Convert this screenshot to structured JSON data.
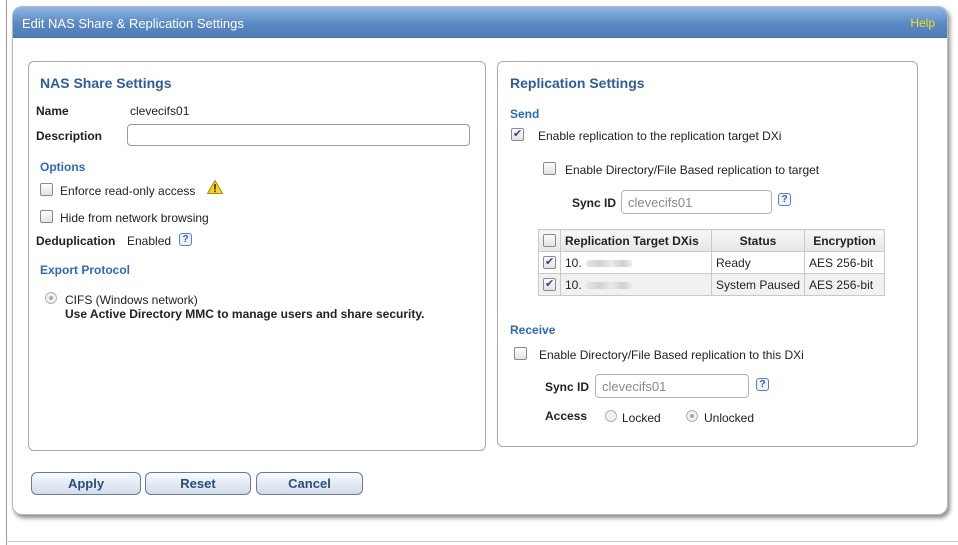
{
  "dialog": {
    "title": "Edit NAS Share & Replication Settings",
    "help": "Help"
  },
  "nas": {
    "title": "NAS Share Settings",
    "name_label": "Name",
    "name_value": "clevecifs01",
    "description_label": "Description",
    "description_value": "",
    "options_heading": "Options",
    "readonly_label": "Enforce read-only access",
    "hide_label": "Hide from network browsing",
    "dedup_label": "Deduplication",
    "dedup_value": "Enabled",
    "export_heading": "Export Protocol",
    "cifs_label": "CIFS (Windows network)",
    "cifs_note": "Use Active Directory MMC to manage users and share security."
  },
  "replication": {
    "title": "Replication Settings",
    "send_heading": "Send",
    "enable_send_label": "Enable replication to the replication target DXi",
    "enable_send_checked": true,
    "enable_dir_send_label": "Enable Directory/File Based replication to target",
    "send_sync_label": "Sync ID",
    "send_sync_value": "clevecifs01",
    "table": {
      "headers": [
        "Replication Target DXis",
        "Status",
        "Encryption"
      ],
      "rows": [
        {
          "target": "10.",
          "status": "Ready",
          "encryption": "AES 256-bit",
          "checked": true
        },
        {
          "target": "10.",
          "status": "System Paused",
          "encryption": "AES 256-bit",
          "checked": true
        }
      ]
    },
    "receive_heading": "Receive",
    "enable_dir_receive_label": "Enable Directory/File Based replication to this DXi",
    "receive_sync_label": "Sync ID",
    "receive_sync_value": "clevecifs01",
    "access_label": "Access",
    "locked_label": "Locked",
    "unlocked_label": "Unlocked",
    "access_selected": "Unlocked"
  },
  "buttons": {
    "apply": "Apply",
    "reset": "Reset",
    "cancel": "Cancel"
  },
  "icons": {
    "help": "question-mark-icon",
    "warning": "warning-triangle-icon"
  },
  "colors": {
    "title_bar": "#5b89c4",
    "help_link": "#f3e11a",
    "section_heading": "#2e5e96"
  }
}
